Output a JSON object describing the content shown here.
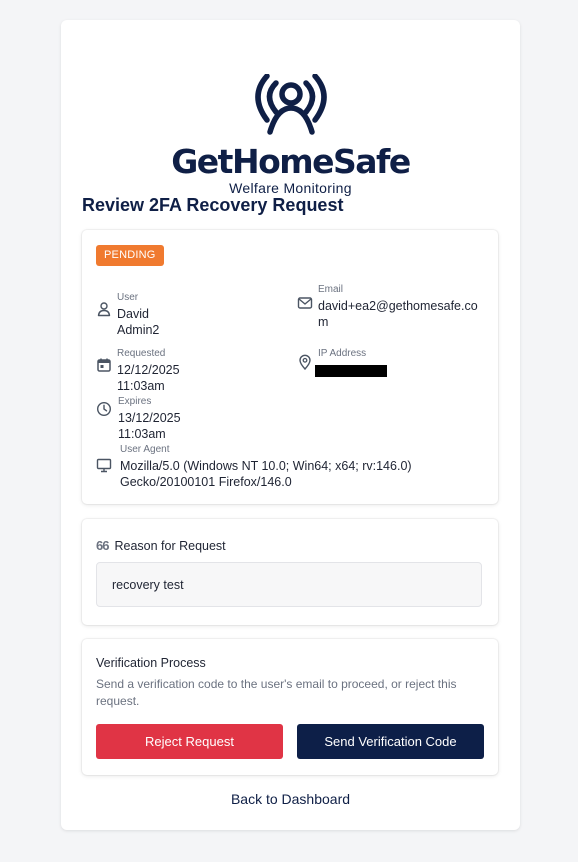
{
  "brand": {
    "name": "GetHomeSafe",
    "tagline": "Welfare Monitoring"
  },
  "page": {
    "title": "Review 2FA Recovery Request"
  },
  "request": {
    "status": "PENDING",
    "user_label": "User",
    "user_value": "David Admin2",
    "email_label": "Email",
    "email_line1": "david+ea2@gethomesafe.co",
    "email_line2": "m",
    "requested_label": "Requested",
    "requested_value": "12/12/2025 11:03am",
    "ip_label": "IP Address",
    "expires_label": "Expires",
    "expires_value": "13/12/2025 11:03am",
    "agent_label": "User Agent",
    "agent_line1": "Mozilla/5.0 (Windows NT 10.0; Win64; x64; rv:146.0)",
    "agent_line2": "Gecko/20100101 Firefox/146.0"
  },
  "reason": {
    "heading": "Reason for Request",
    "quote_glyph": "66",
    "text": "recovery test"
  },
  "verification": {
    "title": "Verification Process",
    "description": "Send a verification code to the user's email to proceed, or reject this request.",
    "reject_label": "Reject Request",
    "send_label": "Send Verification Code"
  },
  "nav": {
    "back_label": "Back to Dashboard"
  },
  "colors": {
    "brand_navy": "#0f1f46",
    "pending": "#f07a2f",
    "reject": "#e03445",
    "send": "#0d1f48"
  },
  "icons": {
    "logo": "person-signal-icon",
    "user": "user-icon",
    "email": "mail-icon",
    "requested": "calendar-icon",
    "ip": "location-pin-icon",
    "expires": "clock-icon",
    "agent": "monitor-icon",
    "reason": "quote-icon"
  }
}
